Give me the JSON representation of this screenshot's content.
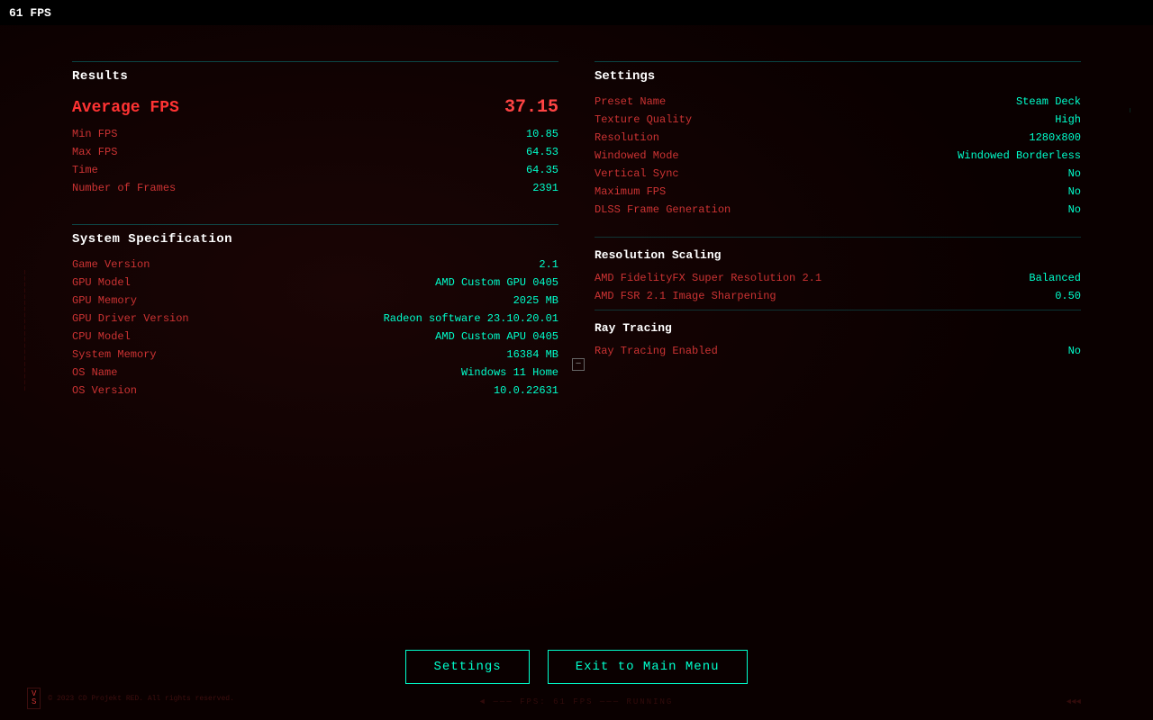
{
  "topbar": {
    "fps": "61 FPS"
  },
  "results": {
    "section_title": "Results",
    "average_fps_label": "Average FPS",
    "average_fps_value": "37.15",
    "rows": [
      {
        "label": "Min FPS",
        "value": "10.85"
      },
      {
        "label": "Max FPS",
        "value": "64.53"
      },
      {
        "label": "Time",
        "value": "64.35"
      },
      {
        "label": "Number of Frames",
        "value": "2391"
      }
    ]
  },
  "system": {
    "section_title": "System Specification",
    "rows": [
      {
        "label": "Game Version",
        "value": "2.1"
      },
      {
        "label": "GPU Model",
        "value": "AMD Custom GPU 0405"
      },
      {
        "label": "GPU Memory",
        "value": "2025 MB"
      },
      {
        "label": "GPU Driver Version",
        "value": "Radeon software 23.10.20.01"
      },
      {
        "label": "CPU Model",
        "value": "AMD Custom APU 0405"
      },
      {
        "label": "System Memory",
        "value": "16384 MB"
      },
      {
        "label": "OS Name",
        "value": "Windows 11 Home"
      },
      {
        "label": "OS Version",
        "value": "10.0.22631"
      }
    ]
  },
  "settings": {
    "section_title": "Settings",
    "rows": [
      {
        "label": "Preset Name",
        "value": "Steam Deck"
      },
      {
        "label": "Texture Quality",
        "value": "High"
      },
      {
        "label": "Resolution",
        "value": "1280x800"
      },
      {
        "label": "Windowed Mode",
        "value": "Windowed Borderless"
      },
      {
        "label": "Vertical Sync",
        "value": "No"
      },
      {
        "label": "Maximum FPS",
        "value": "No"
      },
      {
        "label": "DLSS Frame Generation",
        "value": "No"
      }
    ],
    "resolution_scaling_title": "Resolution Scaling",
    "resolution_scaling_rows": [
      {
        "label": "AMD FidelityFX Super Resolution 2.1",
        "value": "Balanced"
      },
      {
        "label": "AMD FSR 2.1 Image Sharpening",
        "value": "0.50"
      }
    ],
    "ray_tracing_title": "Ray Tracing",
    "ray_tracing_rows": [
      {
        "label": "Ray Tracing Enabled",
        "value": "No"
      }
    ]
  },
  "buttons": {
    "settings_label": "Settings",
    "exit_label": "Exit to Main Menu"
  },
  "decorative": {
    "vs_badge": "V\nS",
    "side_left_text": "SIDE DATA",
    "corner_small_text": "© 2023 CD Projekt RED. All rights reserved.",
    "bottom_deco": "◄ ─── FPS: 61 FPS ─── RUNNING",
    "bottom_right_deco": "◄◄◄"
  }
}
